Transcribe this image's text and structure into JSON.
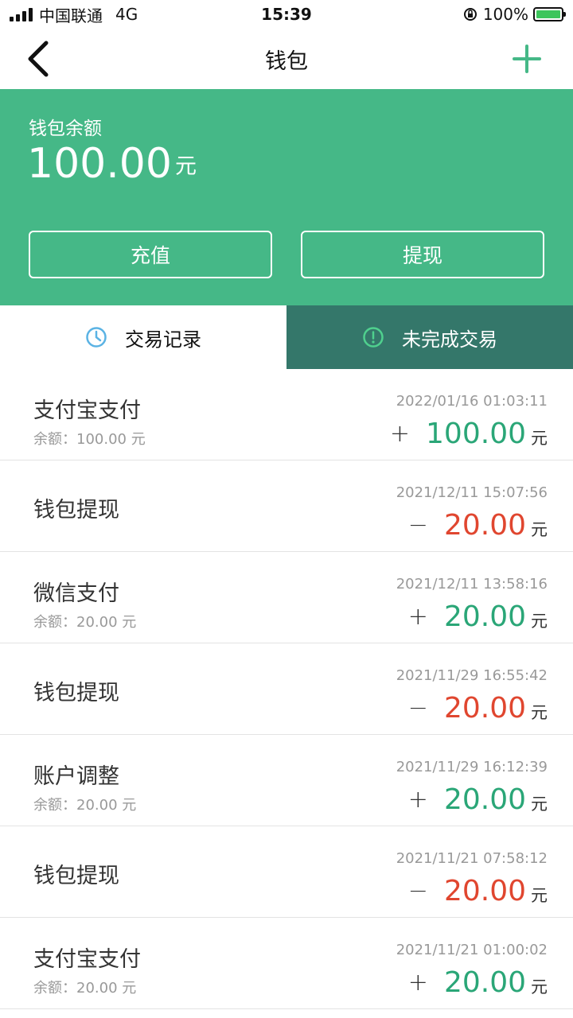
{
  "status_bar": {
    "carrier": "中国联通",
    "network": "4G",
    "time": "15:39",
    "battery": "100%"
  },
  "nav": {
    "title": "钱包",
    "back_icon": "chevron-left-icon",
    "add_icon": "plus-icon"
  },
  "wallet": {
    "balance_label": "钱包余额",
    "balance_amount": "100.00",
    "balance_unit": "元",
    "recharge_label": "充值",
    "withdraw_label": "提现"
  },
  "tabs": [
    {
      "label": "交易记录",
      "icon": "clock-icon"
    },
    {
      "label": "未完成交易",
      "icon": "alert-circle-icon"
    }
  ],
  "transactions": [
    {
      "title": "支付宝支付",
      "balance": "余额：100.00 元",
      "time": "2022/01/16 01:03:11",
      "sign": "+",
      "amount": "100.00",
      "unit": "元"
    },
    {
      "title": "钱包提现",
      "balance": "",
      "time": "2021/12/11 15:07:56",
      "sign": "−",
      "amount": "20.00",
      "unit": "元"
    },
    {
      "title": "微信支付",
      "balance": "余额：20.00 元",
      "time": "2021/12/11 13:58:16",
      "sign": "+",
      "amount": "20.00",
      "unit": "元"
    },
    {
      "title": "钱包提现",
      "balance": "",
      "time": "2021/11/29 16:55:42",
      "sign": "−",
      "amount": "20.00",
      "unit": "元"
    },
    {
      "title": "账户调整",
      "balance": "余额：20.00 元",
      "time": "2021/11/29 16:12:39",
      "sign": "+",
      "amount": "20.00",
      "unit": "元"
    },
    {
      "title": "钱包提现",
      "balance": "",
      "time": "2021/11/21 07:58:12",
      "sign": "−",
      "amount": "20.00",
      "unit": "元"
    },
    {
      "title": "支付宝支付",
      "balance": "余额：20.00 元",
      "time": "2021/11/21 01:00:02",
      "sign": "+",
      "amount": "20.00",
      "unit": "元"
    }
  ],
  "colors": {
    "brand_green": "#45b887",
    "tab_dark": "#34776a",
    "positive": "#2aa677",
    "negative": "#e0462f"
  }
}
